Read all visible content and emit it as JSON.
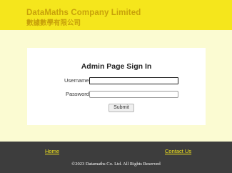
{
  "header": {
    "company_name_en": "DataMaths Company Limited",
    "company_name_zh": "數據數學有限公司"
  },
  "login_form": {
    "title": "Admin Page Sign In",
    "username_label": "Username",
    "username_value": "",
    "password_label": "Password",
    "password_value": "",
    "submit_label": "Submit"
  },
  "footer": {
    "home_link": "Home",
    "contact_link": "Contact Us",
    "copyright": "©2023 Datamaths Co. Ltd.    All Rights Reserved"
  },
  "colors": {
    "header_bg": "#f5e61c",
    "brand_text": "#c8a10a",
    "page_bg": "#fbfbd2",
    "footer_bg": "#3d3d3d",
    "footer_link": "#f5e61c"
  }
}
